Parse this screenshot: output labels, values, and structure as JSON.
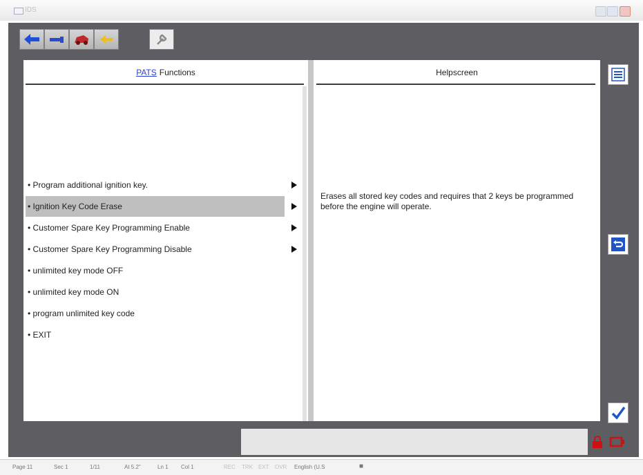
{
  "window": {
    "title": "IDS",
    "icon": "window-icon",
    "controls": [
      "minimize-icon",
      "maximize-icon",
      "close-icon"
    ]
  },
  "toolbar": {
    "tabs": [
      {
        "icon": "back-arrow-icon",
        "color": "#1d4fd8"
      },
      {
        "icon": "cable-icon",
        "color": "#2a4ad0"
      },
      {
        "icon": "car-icon",
        "color": "#c0282a"
      },
      {
        "icon": "return-arrow-icon",
        "color": "#e8c020"
      },
      {
        "icon": "wrench-icon",
        "color": "#9a9a9a",
        "active": true
      }
    ]
  },
  "left_panel": {
    "header_link": "PATS",
    "header_text": "Functions",
    "items": [
      {
        "label": "• Program additional ignition key.",
        "arrow": true
      },
      {
        "label": "• Ignition Key Code Erase",
        "arrow": true,
        "selected": true
      },
      {
        "label": "• Customer Spare Key Programming Enable",
        "arrow": true
      },
      {
        "label": "• Customer Spare Key Programming Disable",
        "arrow": true
      },
      {
        "label": "• unlimited key mode OFF",
        "arrow": false
      },
      {
        "label": "• unlimited key mode ON",
        "arrow": false
      },
      {
        "label": "• program unlimited key code",
        "arrow": false
      },
      {
        "label": "• EXIT",
        "arrow": false
      }
    ]
  },
  "right_panel": {
    "header": "Helpscreen",
    "text": "Erases all stored key codes and requires that 2 keys be programmed before the engine will operate."
  },
  "side_buttons": [
    "list-icon",
    "return-icon",
    "checkmark-icon"
  ],
  "bottom_icons": [
    "padlock-icon",
    "battery-icon"
  ],
  "accent_color": "#1f55c6",
  "statusbar": [
    "Page 11",
    "Sec 1",
    "1/11",
    "At 5.2\"",
    "Ln 1",
    "Col 1",
    "REC",
    "TRK",
    "EXT",
    "OVR",
    "English (U.S",
    "■"
  ]
}
